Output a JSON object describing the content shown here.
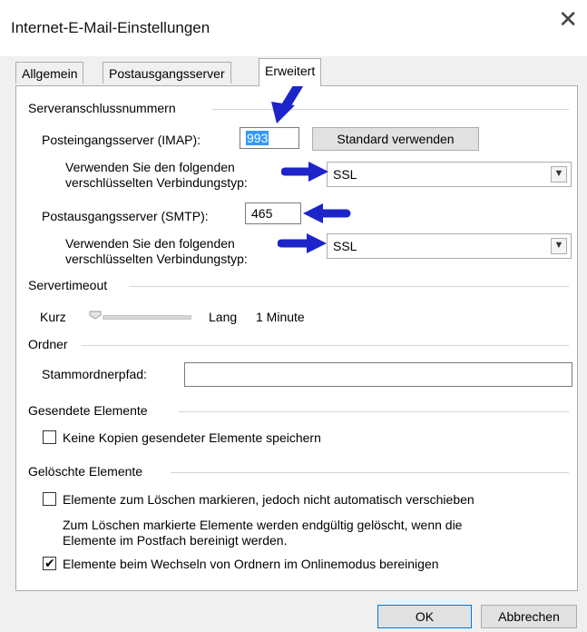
{
  "window": {
    "title": "Internet-E-Mail-Einstellungen",
    "close_glyph": "✕"
  },
  "tabs": [
    {
      "label": "Allgemein",
      "active": false
    },
    {
      "label": "Postausgangsserver",
      "active": false
    },
    {
      "label": "Erweitert",
      "active": true
    }
  ],
  "sections": {
    "ports": "Serveranschlussnummern",
    "timeout": "Servertimeout",
    "folders": "Ordner",
    "sent": "Gesendete Elemente",
    "deleted": "Gelöschte Elemente"
  },
  "ports": {
    "incoming_label": "Posteingangsserver (IMAP):",
    "incoming_value": "993",
    "default_button": "Standard verwenden",
    "incoming_enc_label_1": "Verwenden Sie den folgenden",
    "incoming_enc_label_2": "verschlüsselten Verbindungstyp:",
    "incoming_enc_value": "SSL",
    "outgoing_label": "Postausgangsserver (SMTP):",
    "outgoing_value": "465",
    "outgoing_enc_label_1": "Verwenden Sie den folgenden",
    "outgoing_enc_label_2": "verschlüsselten Verbindungstyp:",
    "outgoing_enc_value": "SSL"
  },
  "timeout": {
    "short_label": "Kurz",
    "long_label": "Lang",
    "value": "1 Minute",
    "level": 0
  },
  "folders": {
    "root_label": "Stammordnerpfad:",
    "root_value": ""
  },
  "sent": {
    "no_copies_label": "Keine Kopien gesendeter Elemente speichern",
    "no_copies_checked": false
  },
  "deleted": {
    "mark_label": "Elemente zum Löschen markieren, jedoch nicht automatisch verschieben",
    "mark_checked": false,
    "info_1": "Zum Löschen markierte Elemente werden endgültig gelöscht, wenn die",
    "info_2": "Elemente im Postfach bereinigt werden.",
    "purge_label": "Elemente beim Wechseln von Ordnern im Onlinemodus bereinigen",
    "purge_checked": true
  },
  "buttons": {
    "ok": "OK",
    "cancel": "Abbrechen"
  },
  "colors": {
    "accent": "#0078d7",
    "selection": "#3399ff",
    "arrow": "#1d24c9"
  }
}
